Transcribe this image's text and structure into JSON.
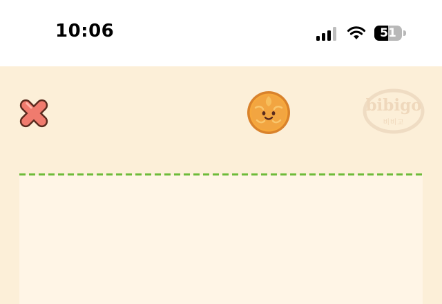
{
  "status_bar": {
    "time": "10:06",
    "battery_level": "51",
    "signal_icon": "cellular-signal-icon",
    "wifi_icon": "wifi-icon",
    "battery_icon": "battery-icon"
  },
  "header": {
    "close_icon": "close-icon",
    "mascot_icon": "smiling-dumpling-coin-icon",
    "brand_logo": {
      "text": "bibigo",
      "subtext": "비비고"
    }
  },
  "colors": {
    "background": "#FCEFD8",
    "play_area": "#FFF5E6",
    "limit_line": "#6DBB3A",
    "close_red": "#F07B6E",
    "coin_orange": "#F2A541",
    "logo_faded": "#EFDCC3"
  }
}
